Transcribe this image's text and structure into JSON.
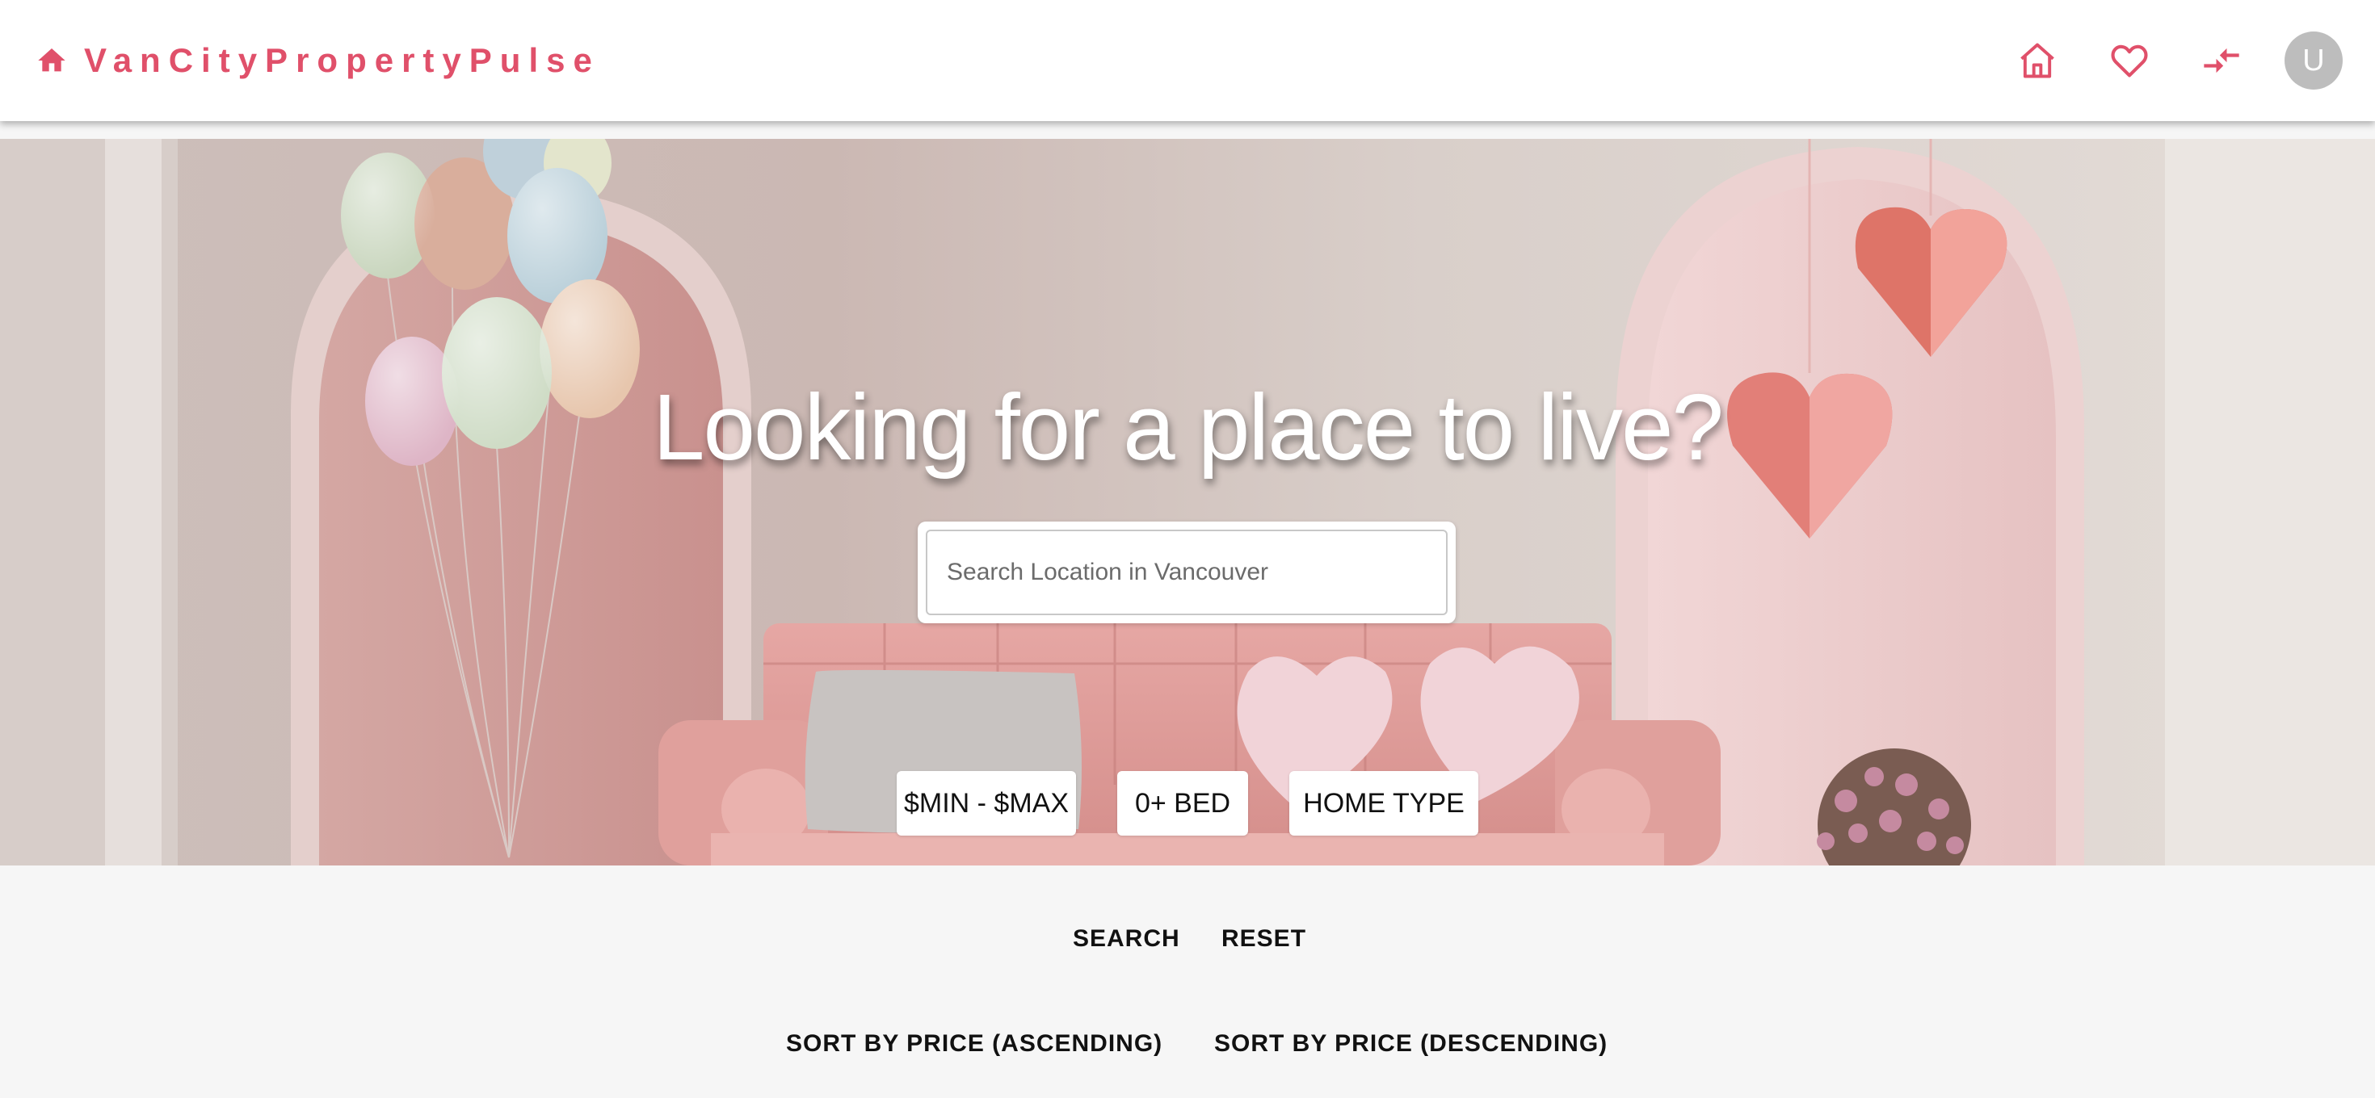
{
  "header": {
    "brand_name": "VanCityPropertyPulse",
    "brand_icon": "home-icon",
    "accent_color": "#e0506a",
    "nav": [
      {
        "name": "home",
        "icon": "home-outline-icon"
      },
      {
        "name": "favorites",
        "icon": "heart-icon"
      },
      {
        "name": "compare",
        "icon": "compare-arrows-icon"
      }
    ],
    "avatar_initial": "U"
  },
  "hero": {
    "title": "Looking for a place to live?",
    "search_placeholder": "Search Location in Vancouver",
    "filters": {
      "price_label": "$MIN - $MAX",
      "bed_label": "0+ BED",
      "type_label": "HOME TYPE"
    }
  },
  "actions": {
    "search_label": "SEARCH",
    "reset_label": "RESET",
    "sort_asc_label": "SORT BY PRICE (ASCENDING)",
    "sort_desc_label": "SORT BY PRICE (DESCENDING)"
  }
}
